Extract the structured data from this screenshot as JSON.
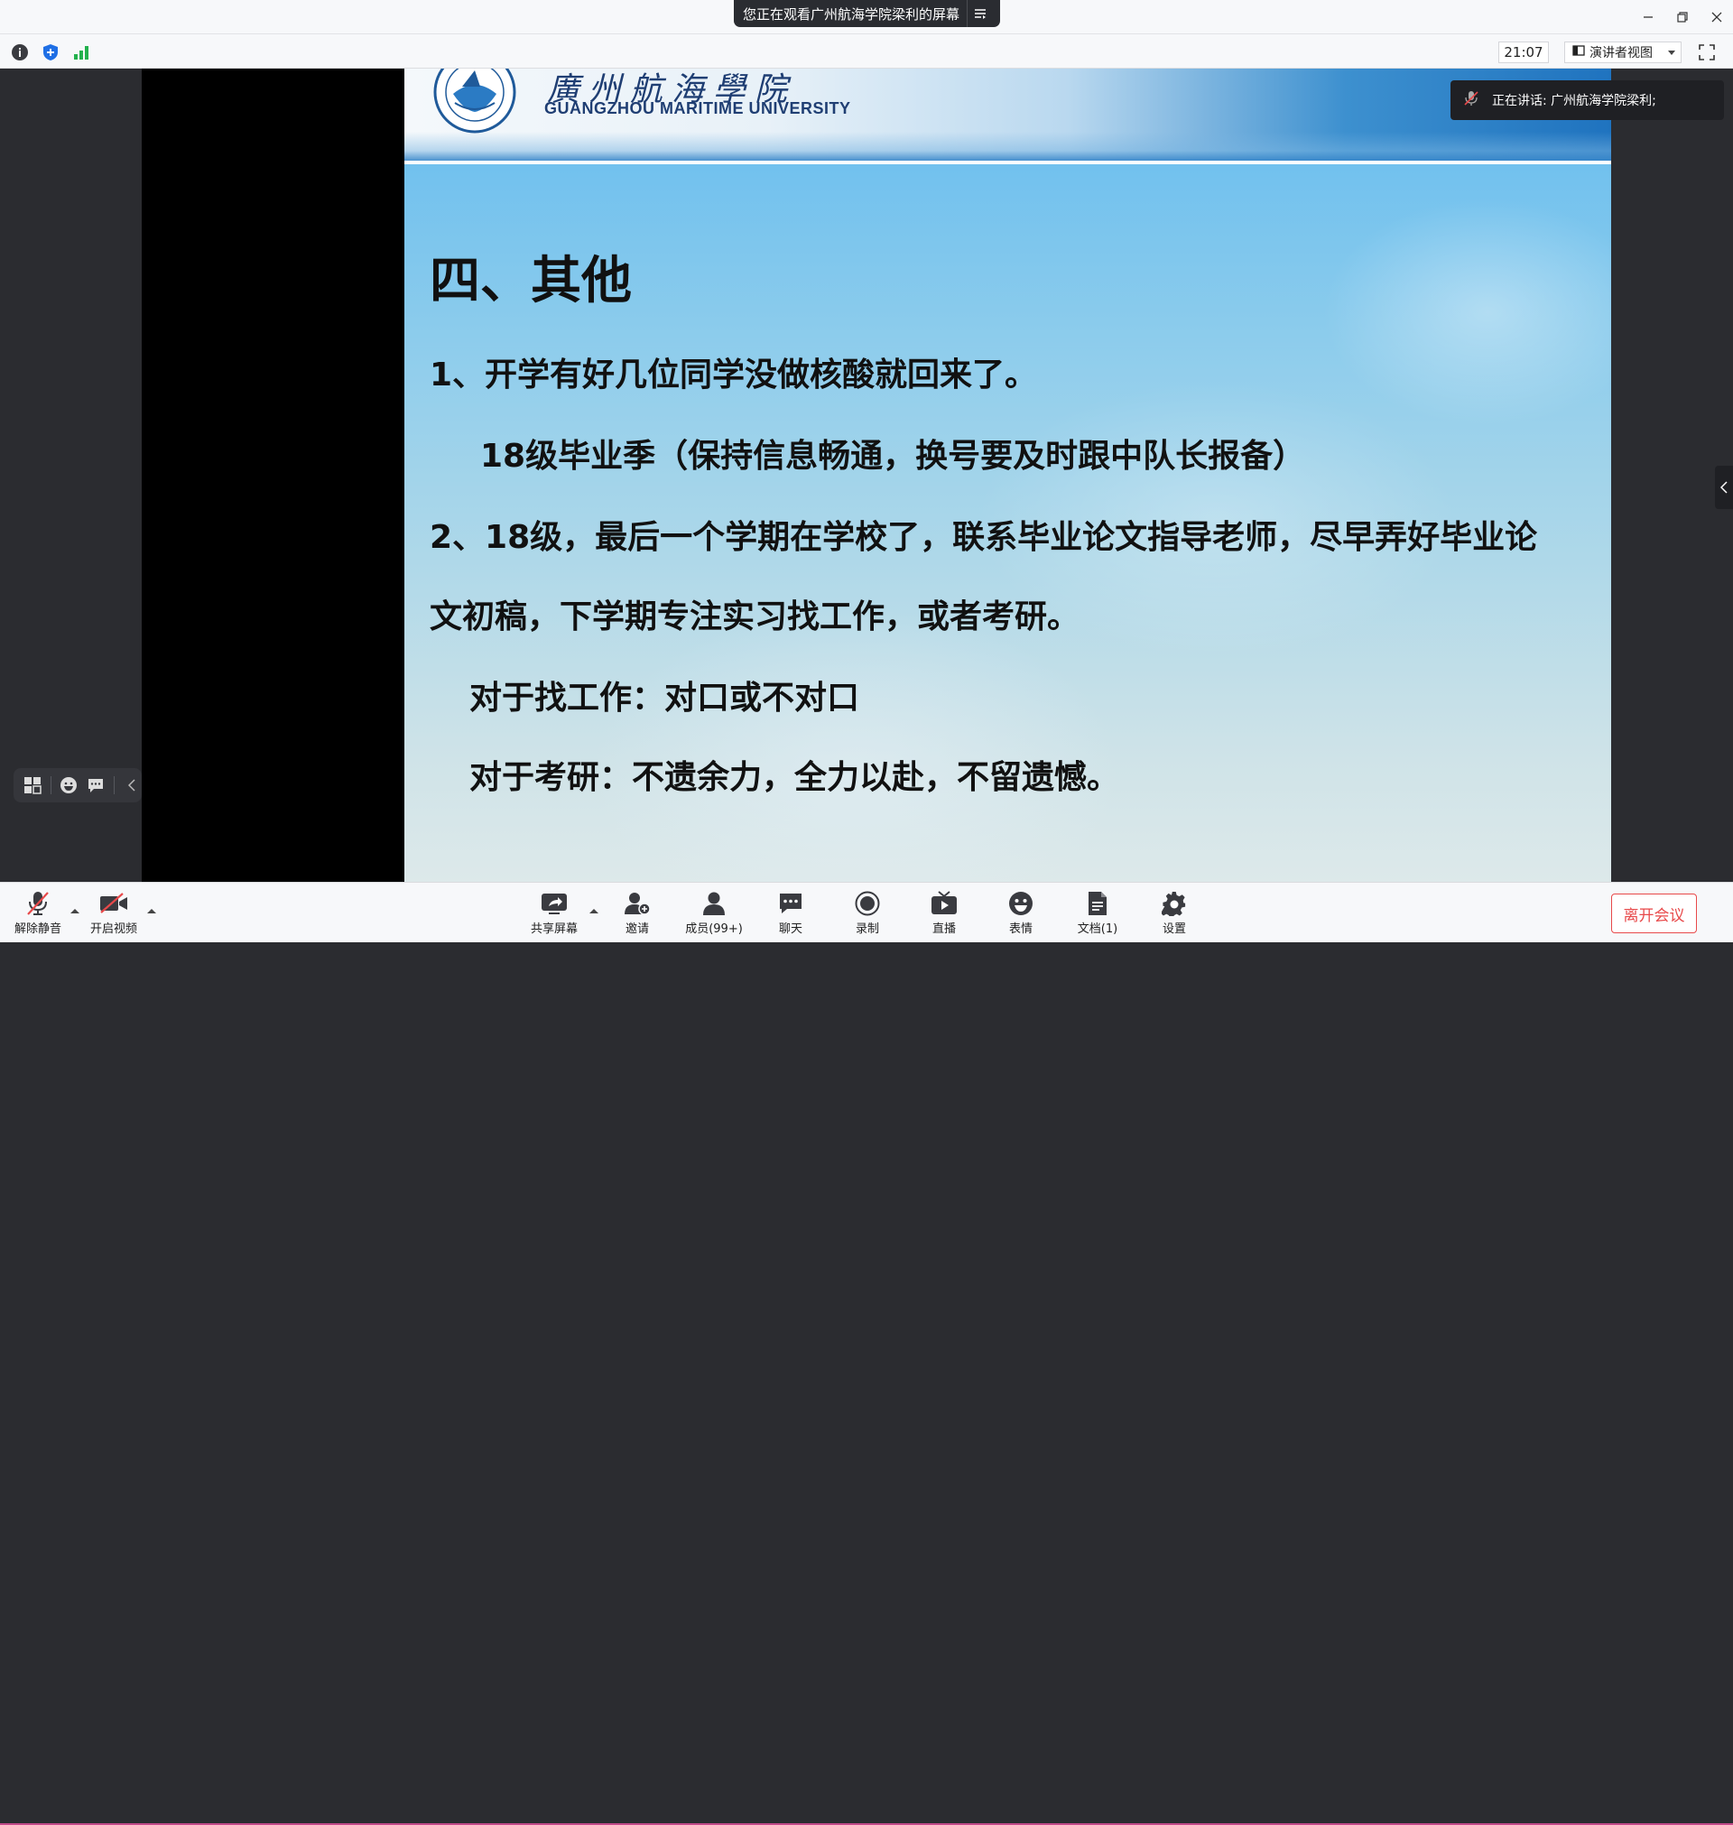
{
  "titlebar": {
    "banner_text": "您正在观看广州航海学院梁利的屏幕"
  },
  "infobar": {
    "clock": "21:07",
    "view_mode": "演讲者视图"
  },
  "speaker": {
    "text": "正在讲话: 广州航海学院梁利;"
  },
  "slide": {
    "university_cn": "廣州航海學院",
    "university_en": "GUANGZHOU MARITIME UNIVERSITY",
    "title": "四、其他",
    "lines": [
      "1、开学有好几位同学没做核酸就回来了。",
      "18级毕业季（保持信息畅通，换号要及时跟中队长报备）",
      "2、18级，最后一个学期在学校了，联系毕业论文指导老师，尽早弄好毕业论",
      "文初稿，下学期专注实习找工作，或者考研。",
      "对于找工作：对口或不对口",
      "对于考研：不遗余力，全力以赴，不留遗憾。"
    ]
  },
  "toolbar": {
    "unmute": "解除静音",
    "start_video": "开启视频",
    "share_screen": "共享屏幕",
    "invite": "邀请",
    "members": "成员(99+)",
    "chat": "聊天",
    "record": "录制",
    "live": "直播",
    "reactions": "表情",
    "docs": "文档(1)",
    "settings": "设置",
    "leave": "离开会议"
  },
  "colors": {
    "accent_red": "#e8494a",
    "bar_bg": "#f7f8fa",
    "stage_bg": "#2b2c30"
  }
}
